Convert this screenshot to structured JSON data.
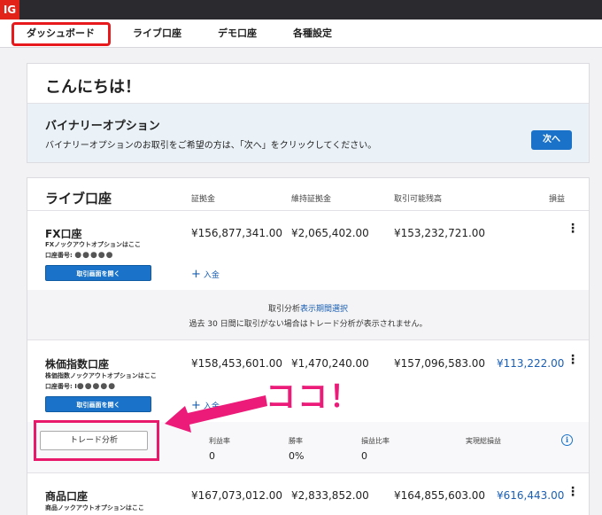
{
  "app": {
    "logo": "IG"
  },
  "nav": {
    "items": [
      {
        "label": "ダッシュボード"
      },
      {
        "label": "ライブ口座"
      },
      {
        "label": "デモ口座"
      },
      {
        "label": "各種設定"
      }
    ]
  },
  "greeting": {
    "title": "こんにちは！"
  },
  "binary": {
    "title": "バイナリーオプション",
    "description": "バイナリーオプションのお取引をご希望の方は、「次へ」をクリックしてください。",
    "next_label": "次へ"
  },
  "live": {
    "title": "ライブ口座",
    "columns": {
      "margin": "証拠金",
      "maintenance": "維持証拠金",
      "available": "取引可能残高",
      "pl": "損益"
    },
    "accounts": [
      {
        "name": "FX口座",
        "sub": "FXノックアウトオプションはここ",
        "acct_no_label": "口座番号: ",
        "acct_no": "●●●●●",
        "open_label": "取引画面を開く",
        "margin": "¥156,877,341.00",
        "maintenance": "¥2,065,402.00",
        "available": "¥153,232,721.00",
        "pl": "",
        "deposit_label": "入金"
      },
      {
        "name": "株価指数口座",
        "sub": "株価指数ノックアウトオプションはここ",
        "acct_no_label": "口座番号: I",
        "acct_no": "●●●●●",
        "open_label": "取引画面を開く",
        "margin": "¥158,453,601.00",
        "maintenance": "¥1,470,240.00",
        "available": "¥157,096,583.00",
        "pl": "¥113,222.00",
        "deposit_label": "入金"
      },
      {
        "name": "商品口座",
        "sub": "商品ノックアウトオプションはここ",
        "margin": "¥167,073,012.00",
        "maintenance": "¥2,833,852.00",
        "available": "¥164,855,603.00",
        "pl": "¥616,443.00"
      }
    ],
    "analysis": {
      "prefix": "取引分析",
      "link": "表示期間選択",
      "note": "過去 30 日間に取引がない場合はトレード分析が表示されません。"
    },
    "metrics": {
      "trade_button": "トレード分析",
      "headers": [
        "利益率",
        "勝率",
        "損益比率",
        "実現総損益"
      ],
      "values": [
        "0",
        "0%",
        "0",
        ""
      ]
    }
  },
  "annotation": {
    "callout": "ココ！"
  },
  "colors": {
    "accent": "#1a73c8",
    "highlight": "#e8191d",
    "callout": "#ec1a78"
  }
}
